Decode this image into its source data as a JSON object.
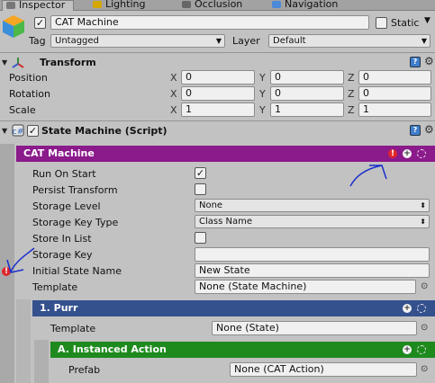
{
  "tabs": [
    {
      "label": "Inspector",
      "icon": "inspector-icon"
    },
    {
      "label": "Lighting",
      "icon": "lighting-icon"
    },
    {
      "label": "Occlusion",
      "icon": "occlusion-icon"
    },
    {
      "label": "Navigation",
      "icon": "navigation-icon"
    }
  ],
  "header": {
    "object_name": "CAT Machine",
    "static_label": "Static",
    "tag_label": "Tag",
    "tag_value": "Untagged",
    "layer_label": "Layer",
    "layer_value": "Default"
  },
  "transform": {
    "title": "Transform",
    "rows": [
      {
        "label": "Position",
        "x": "0",
        "y": "0",
        "z": "0"
      },
      {
        "label": "Rotation",
        "x": "0",
        "y": "0",
        "z": "0"
      },
      {
        "label": "Scale",
        "x": "1",
        "y": "1",
        "z": "1"
      }
    ],
    "axis_x": "X",
    "axis_y": "Y",
    "axis_z": "Z"
  },
  "state_machine": {
    "title": "State Machine (Script)",
    "bar_title": "CAT Machine",
    "bar_color": "#8b1a8b",
    "props": {
      "run_on_start": "Run On Start",
      "persist_transform": "Persist Transform",
      "storage_level": "Storage Level",
      "storage_level_value": "None",
      "storage_key_type": "Storage Key Type",
      "storage_key_type_value": "Class Name",
      "store_in_list": "Store In List",
      "storage_key": "Storage Key",
      "storage_key_value": "",
      "initial_state_name": "Initial State Name",
      "initial_state_value": "New State",
      "template": "Template",
      "template_value": "None (State Machine)"
    }
  },
  "purr": {
    "bar_title": "1. Purr",
    "bar_color": "#34518e",
    "template_label": "Template",
    "template_value": "None (State)"
  },
  "action": {
    "bar_title": "A. Instanced Action",
    "bar_color": "#1e8a1e",
    "prefab_label": "Prefab",
    "prefab_value": "None (CAT Action)"
  }
}
